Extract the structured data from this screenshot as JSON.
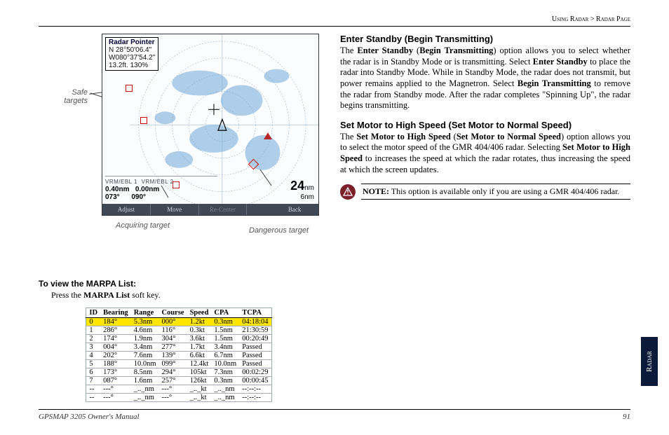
{
  "header": {
    "breadcrumb_left": "Using Radar",
    "sep": " > ",
    "breadcrumb_right": "Radar Page"
  },
  "radar": {
    "pointer_title": "Radar Pointer",
    "pointer_lat": "N 28°50'06.4\"",
    "pointer_lon": "W080°37'54.2\"",
    "pointer_dist": "13.2ft.   130%",
    "vrm1_label": "VRM/EBL 1",
    "vrm2_label": "VRM/EBL 2",
    "vrm1_dist": "0.40nm",
    "vrm2_dist": "0.00nm",
    "vrm1_brg": "073°",
    "vrm2_brg": "090°",
    "range_big": "24",
    "range_unit": "nm",
    "ring_gap": "6nm",
    "softkeys": {
      "adjust": "Adjust",
      "move": "Move",
      "recenter": "Re-Center",
      "back": "Back"
    }
  },
  "annotations": {
    "safe": "Safe\ntargets",
    "acquiring": "Acquiring target",
    "dangerous": "Dangerous target"
  },
  "marpa": {
    "heading": "To view the MARPA List:",
    "instruction_pre": "Press the ",
    "instruction_b": "MARPA List",
    "instruction_post": " soft key.",
    "headers": [
      "ID",
      "Bearing",
      "Range",
      "Course",
      "Speed",
      "CPA",
      "TCPA"
    ],
    "rows": [
      [
        "0",
        "184°",
        "5.3nm",
        "000°",
        "1.2kt",
        "0.3nm",
        "04:18:04"
      ],
      [
        "1",
        "286°",
        "4.6nm",
        "116°",
        "0.3kt",
        "1.5nm",
        "21:30:59"
      ],
      [
        "2",
        "174°",
        "1.9nm",
        "304°",
        "3.6kt",
        "1.5nm",
        "00:20:49"
      ],
      [
        "3",
        "004°",
        "3.4nm",
        "277°",
        "1.7kt",
        "3.4nm",
        "Passed"
      ],
      [
        "4",
        "202°",
        "7.6nm",
        "139°",
        "6.6kt",
        "6.7nm",
        "Passed"
      ],
      [
        "5",
        "188°",
        "10.0nm",
        "099°",
        "12.4kt",
        "10.0nm",
        "Passed"
      ],
      [
        "6",
        "173°",
        "8.5nm",
        "294°",
        "105kt",
        "7.3nm",
        "00:02:29"
      ],
      [
        "7",
        "087°",
        "1.6nm",
        "257°",
        "126kt",
        "0.3nm",
        "00:00:45"
      ],
      [
        "--",
        "---°",
        "_.._nm",
        "---°",
        "_.._kt",
        "_.._nm",
        "--:--:--"
      ],
      [
        "--",
        "---°",
        "_.._nm",
        "---°",
        "_.._kt",
        "_.._nm",
        "--:--:--"
      ]
    ]
  },
  "sections": {
    "s1_h": "Enter Standby (Begin Transmitting)",
    "s1_p": "The Enter Standby (Begin Transmitting) option allows you to select whether the radar is in Standby Mode or is transmitting. Select Enter Standby to place the radar into Standby Mode. While in Standby Mode, the radar does not transmit, but power remains applied to the Magnetron. Select Begin Transmitting to remove the radar from Standby mode. After the radar completes \"Spinning Up\", the radar begins transmitting.",
    "s2_h": "Set Motor to High Speed (Set Motor to Normal Speed)",
    "s2_p": "The Set Motor to High Speed (Set Motor to Normal Speed) option allows you to select the motor speed of the GMR 404/406 radar. Selecting Set Motor to High Speed to increases the speed at which the radar rotates, thus increasing the speed at which the screen updates.",
    "note_label": "NOTE:",
    "note": " This option is available only if you are using a GMR 404/406 radar."
  },
  "sidetab": "Radar",
  "footer": {
    "left": "GPSMAP 3205 Owner's Manual",
    "right": "91"
  },
  "chart_data": {
    "type": "table",
    "title": "MARPA List",
    "columns": [
      "ID",
      "Bearing (deg)",
      "Range (nm)",
      "Course (deg)",
      "Speed (kt)",
      "CPA (nm)",
      "TCPA"
    ],
    "series": [
      {
        "name": "row0",
        "values": [
          0,
          184,
          5.3,
          0,
          1.2,
          0.3,
          "04:18:04"
        ]
      },
      {
        "name": "row1",
        "values": [
          1,
          286,
          4.6,
          116,
          0.3,
          1.5,
          "21:30:59"
        ]
      },
      {
        "name": "row2",
        "values": [
          2,
          174,
          1.9,
          304,
          3.6,
          1.5,
          "00:20:49"
        ]
      },
      {
        "name": "row3",
        "values": [
          3,
          4,
          3.4,
          277,
          1.7,
          3.4,
          "Passed"
        ]
      },
      {
        "name": "row4",
        "values": [
          4,
          202,
          7.6,
          139,
          6.6,
          6.7,
          "Passed"
        ]
      },
      {
        "name": "row5",
        "values": [
          5,
          188,
          10.0,
          99,
          12.4,
          10.0,
          "Passed"
        ]
      },
      {
        "name": "row6",
        "values": [
          6,
          173,
          8.5,
          294,
          105,
          7.3,
          "00:02:29"
        ]
      },
      {
        "name": "row7",
        "values": [
          7,
          87,
          1.6,
          257,
          126,
          0.3,
          "00:00:45"
        ]
      }
    ]
  }
}
